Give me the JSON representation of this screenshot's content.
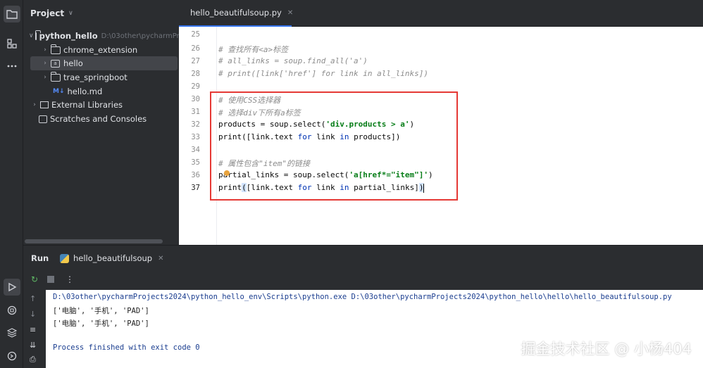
{
  "project_panel": {
    "title": "Project",
    "tree": [
      {
        "label": "python_hello",
        "hint": "D:\\03other\\pycharmPr"
      },
      {
        "label": "chrome_extension"
      },
      {
        "label": "hello"
      },
      {
        "label": "trae_springboot"
      },
      {
        "label": "hello.md",
        "icon_text": "M↓"
      },
      {
        "label": "External Libraries"
      },
      {
        "label": "Scratches and Consoles"
      }
    ]
  },
  "editor": {
    "tab_label": "hello_beautifulsoup.py",
    "line_numbers": [
      "25",
      "26",
      "27",
      "28",
      "29",
      "30",
      "31",
      "32",
      "33",
      "34",
      "35",
      "36",
      "37"
    ],
    "lines": {
      "l26": "# 查找所有<a>标签",
      "l27": "# all_links = soup.find_all('a')",
      "l28": "# print([link['href'] for link in all_links])",
      "l30": "# 使用CSS选择器",
      "l31": "# 选择div下所有a标签",
      "l32_a": "products = soup.select(",
      "l32_b": "'div.products > a'",
      "l32_c": ")",
      "l33_a": "print([link.text ",
      "l33_b": "for",
      "l33_c": " link ",
      "l33_d": "in",
      "l33_e": " products])",
      "l35": "# 属性包含\"item\"的链接",
      "l36_a": "partial_links = soup.select(",
      "l36_b": "'a[href*=\"item\"]'",
      "l36_c": ")",
      "l37_a": "print",
      "l37_b": "(",
      "l37_c": "[link.text ",
      "l37_d": "for",
      "l37_e": " link ",
      "l37_f": "in",
      "l37_g": " partial_links]",
      "l37_h": ")"
    }
  },
  "run": {
    "title": "Run",
    "tab_label": "hello_beautifulsoup",
    "output": [
      "D:\\03other\\pycharmProjects2024\\python_hello_env\\Scripts\\python.exe D:\\03other\\pycharmProjects2024\\python_hello\\hello\\hello_beautifulsoup.py",
      "['电脑', '手机', 'PAD']",
      "['电脑', '手机', 'PAD']",
      "",
      "Process finished with exit code 0"
    ]
  },
  "watermark": "掘金技术社区 @ 小杨404",
  "colors": {
    "ide_dark": "#2b2d30",
    "selection": "#43454a",
    "accent": "#3574f0",
    "highlight_box": "#e53935",
    "string": "#067d17",
    "keyword": "#0033b3",
    "comment": "#8c8c8c",
    "console_text": "#1a3d8f"
  }
}
